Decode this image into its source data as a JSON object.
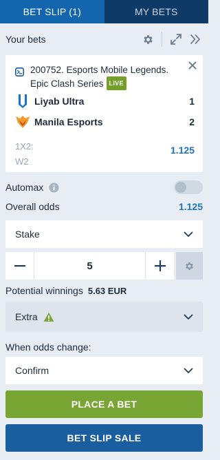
{
  "tabs": [
    {
      "label": "BET SLIP (1)",
      "active": true
    },
    {
      "label": "MY BETS",
      "active": false
    }
  ],
  "header": {
    "title": "Your bets"
  },
  "bet": {
    "match_title": "200752. Esports Mobile Legends. Epic Clash Series",
    "live_label": "LIVE",
    "teams": [
      {
        "name": "Liyab Ultra",
        "score": "1"
      },
      {
        "name": "Manila Esports",
        "score": "2"
      }
    ],
    "market_type": "1X2:",
    "selection": "W2",
    "odds": "1.125"
  },
  "automax": {
    "label": "Automax",
    "enabled": false
  },
  "overall_odds": {
    "label": "Overall odds",
    "value": "1.125"
  },
  "stake": {
    "label": "Stake",
    "amount": "5"
  },
  "potential": {
    "label": "Potential winnings",
    "value": "5.63 EUR"
  },
  "extra": {
    "label": "Extra"
  },
  "odds_change": {
    "label": "When odds change:",
    "selected": "Confirm"
  },
  "buttons": {
    "place_bet": "PLACE A BET",
    "sale": "BET SLIP SALE"
  },
  "colors": {
    "tab_active": "#1366ad",
    "tab_inactive": "#0e3a66",
    "accent_blue": "#1a73c4",
    "live_green": "#74a02a",
    "place_green": "#79a534",
    "sale_blue": "#1a5ea0"
  },
  "icons": [
    "gear-icon",
    "expand-icon",
    "double-chevron-right-icon",
    "close-icon",
    "esports-icon",
    "info-icon",
    "chevron-down-icon",
    "minus-icon",
    "plus-icon",
    "warning-icon"
  ]
}
